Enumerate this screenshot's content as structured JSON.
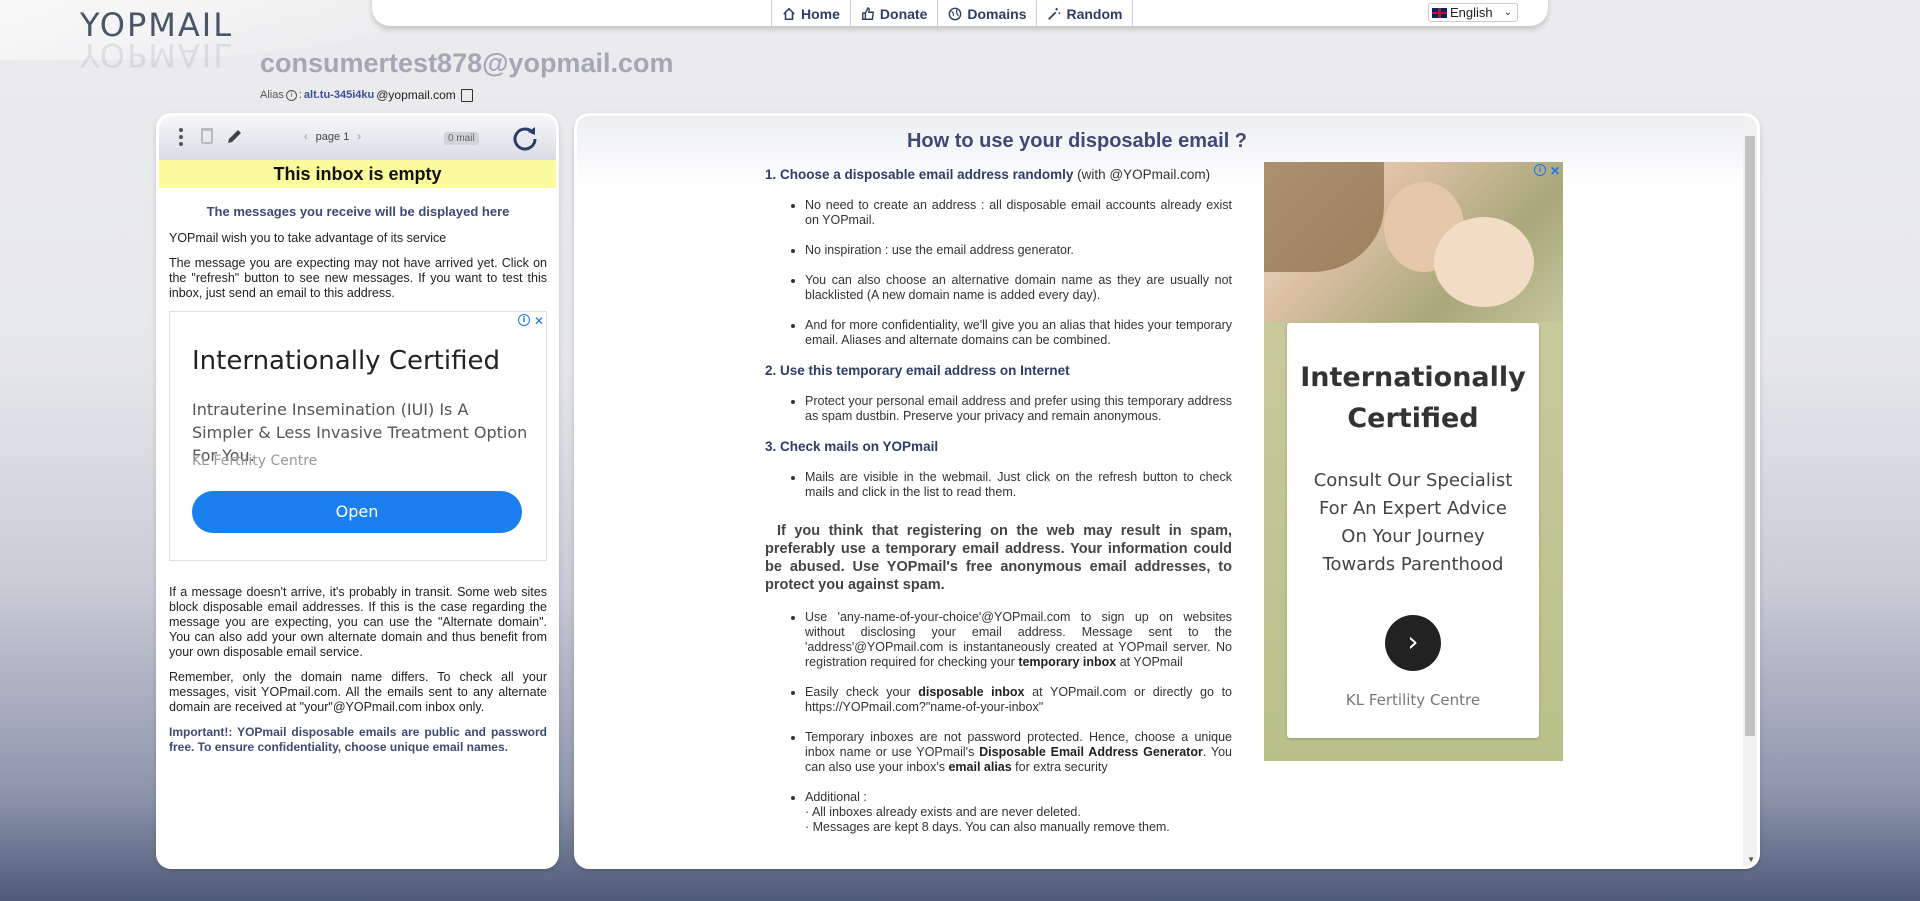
{
  "logo": {
    "text": "YOPMAIL"
  },
  "nav": {
    "items": [
      {
        "label": "Home",
        "icon": "home-icon"
      },
      {
        "label": "Donate",
        "icon": "thumbs-up-icon"
      },
      {
        "label": "Domains",
        "icon": "globe-icon"
      },
      {
        "label": "Random",
        "icon": "magic-wand-icon"
      }
    ],
    "language": "English"
  },
  "inbox": {
    "address": "consumertest878@yopmail.com",
    "alias_label": "Alias",
    "alias_name": "alt.tu-345i4ku",
    "alias_domain": "@yopmail.com"
  },
  "left_panel": {
    "pager": "page 1",
    "mail_count": "0 mail",
    "empty_banner": "This inbox is empty",
    "subtitle": "The messages you receive will be displayed here",
    "p1": "YOPmail wish you to take advantage of its service",
    "p2": "The message you are expecting may not have arrived yet. Click on the \"refresh\" button to see new messages. If you want to test this inbox, just send an email to this address.",
    "ad": {
      "title": "Internationally Certified",
      "body": "Intrauterine Insemination (IUI) Is A Simpler & Less Invasive Treatment Option For You.",
      "brand": "KL Fertility Centre",
      "button": "Open"
    },
    "p3": "If a message doesn't arrive, it's probably in transit. Some web sites block disposable email addresses. If this is the case regarding the message you are expecting, you can use the \"Alternate domain\". You can also add your own alternate domain and thus benefit from your own disposable email service.",
    "p4": "Remember, only the domain name differs. To check all your messages, visit YOPmail.com. All the emails sent to any alternate domain are received at \"your\"@YOPmail.com inbox only.",
    "important": "Important!: YOPmail disposable emails are public and password free. To ensure confidentiality, choose unique email names."
  },
  "right_panel": {
    "title": "How to use your disposable email ?",
    "s1_title": "1. Choose a disposable email address randomly",
    "s1_suffix": "(with @YOPmail.com)",
    "s1_items": [
      "No need to create an address : all disposable email accounts already exist on YOPmail.",
      "No inspiration : use the email address generator.",
      "You can also choose an alternative domain name as they are usually not blacklisted (A new domain name is added every day).",
      "And for more confidentiality, we'll give you an alias that hides your temporary email. Aliases and alternate domains can be combined."
    ],
    "s2_title": "2. Use this temporary email address on Internet",
    "s2_items": [
      "Protect your personal email address and prefer using this temporary address as spam dustbin. Preserve your privacy and remain anonymous."
    ],
    "s3_title": "3. Check mails on YOPmail",
    "s3_items": [
      "Mails are visible in the webmail. Just click on the refresh button to check mails and click in the list to read them."
    ],
    "spam_paragraph": "If you think that registering on the web may result in spam, preferably use a temporary email address. Your information could be abused. Use YOPmail's free anonymous email addresses, to protect you against spam.",
    "b1_pre": "Use 'any-name-of-your-choice'@YOPmail.com to sign up on websites without disclosing your email address. Message sent to the 'address'@YOPmail.com is instantaneously created at YOPmail server. No registration required for checking your ",
    "b1_bold": "temporary inbox",
    "b1_post": " at YOPmail",
    "b2_pre": "Easily check your ",
    "b2_bold": "disposable inbox",
    "b2_post": " at YOPmail.com or directly go to https://YOPmail.com?\"name-of-your-inbox\"",
    "b3_pre": "Temporary inboxes are not password protected. Hence, choose a unique inbox name or use YOPmail's ",
    "b3_bold": "Disposable Email Address Generator",
    "b3_mid": ". You can also use your inbox's ",
    "b3_bold2": "email alias",
    "b3_post": " for extra security",
    "b4_title": "Additional :",
    "b4_line1": "· All inboxes already exists and are never deleted.",
    "b4_line2": "· Messages are kept 8 days. You can also manually remove them.",
    "ad": {
      "title": "Internationally Certified",
      "body": "Consult Our Specialist For An Expert Advice On Your Journey Towards Parenthood",
      "brand": "KL Fertility Centre",
      "button": "›"
    }
  },
  "colors": {
    "accent": "#2c3e67",
    "banner": "#fbfb9e",
    "ad_button": "#1a7fef"
  }
}
